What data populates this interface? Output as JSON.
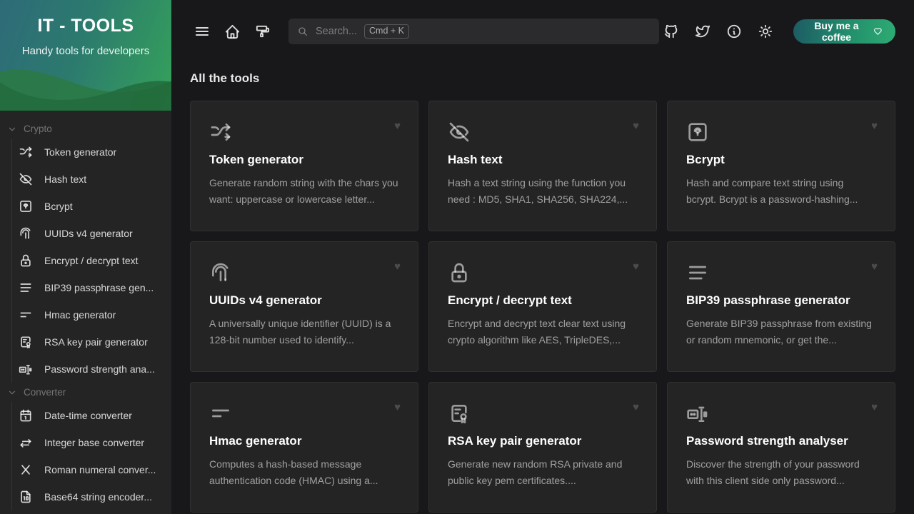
{
  "brand": {
    "title": "IT - TOOLS",
    "subtitle": "Handy tools for developers"
  },
  "colors": {
    "accent_green": "#2eab73",
    "accent_teal": "#1d5b64",
    "sidebar_bg": "#242424",
    "page_bg": "#18181a",
    "card_bg": "#242424"
  },
  "topbar": {
    "menu_label": "Menu",
    "home_label": "Home",
    "theme_label": "Theme",
    "github_label": "Github",
    "twitter_label": "Twitter",
    "about_label": "About",
    "lightmode_label": "Light mode",
    "coffee_label": "Buy me a coffee"
  },
  "search": {
    "placeholder": "Search...",
    "shortcut": "Cmd + K"
  },
  "sidebar": {
    "groups": [
      {
        "label": "Crypto",
        "items": [
          {
            "label": "Token generator",
            "icon": "shuffle-icon"
          },
          {
            "label": "Hash text",
            "icon": "eye-off-icon"
          },
          {
            "label": "Bcrypt",
            "icon": "lock-square-icon"
          },
          {
            "label": "UUIDs v4 generator",
            "icon": "fingerprint-icon"
          },
          {
            "label": "Encrypt / decrypt text",
            "icon": "lock-icon"
          },
          {
            "label": "BIP39 passphrase gen...",
            "icon": "lines-icon"
          },
          {
            "label": "Hmac generator",
            "icon": "short-lines-icon"
          },
          {
            "label": "RSA key pair generator",
            "icon": "certificate-icon"
          },
          {
            "label": "Password strength ana...",
            "icon": "password-icon"
          }
        ]
      },
      {
        "label": "Converter",
        "items": [
          {
            "label": "Date-time converter",
            "icon": "calendar-icon"
          },
          {
            "label": "Integer base converter",
            "icon": "arrows-exchange-icon"
          },
          {
            "label": "Roman numeral conver...",
            "icon": "letter-x-icon"
          },
          {
            "label": "Base64 string encoder...",
            "icon": "file-digit-icon"
          }
        ]
      }
    ]
  },
  "main": {
    "section_title": "All the tools",
    "cards": [
      {
        "icon": "shuffle-icon",
        "title": "Token generator",
        "desc": "Generate random string with the chars you want: uppercase or lowercase letter...",
        "fav": "♥"
      },
      {
        "icon": "eye-off-icon",
        "title": "Hash text",
        "desc": "Hash a text string using the function you need : MD5, SHA1, SHA256, SHA224,...",
        "fav": "♥"
      },
      {
        "icon": "lock-square-icon",
        "title": "Bcrypt",
        "desc": "Hash and compare text string using bcrypt. Bcrypt is a password-hashing...",
        "fav": "♥"
      },
      {
        "icon": "fingerprint-icon",
        "title": "UUIDs v4 generator",
        "desc": "A universally unique identifier (UUID) is a 128-bit number used to identify...",
        "fav": "♥"
      },
      {
        "icon": "lock-icon",
        "title": "Encrypt / decrypt text",
        "desc": "Encrypt and decrypt text clear text using crypto algorithm like AES, TripleDES,...",
        "fav": "♥"
      },
      {
        "icon": "lines-icon",
        "title": "BIP39 passphrase generator",
        "desc": "Generate BIP39 passphrase from existing or random mnemonic, or get the...",
        "fav": "♥"
      },
      {
        "icon": "short-lines-icon",
        "title": "Hmac generator",
        "desc": "Computes a hash-based message authentication code (HMAC) using a...",
        "fav": "♥"
      },
      {
        "icon": "certificate-icon",
        "title": "RSA key pair generator",
        "desc": "Generate new random RSA private and public key pem certificates....",
        "fav": "♥"
      },
      {
        "icon": "password-icon",
        "title": "Password strength analyser",
        "desc": "Discover the strength of your password with this client side only password...",
        "fav": "♥"
      }
    ]
  }
}
